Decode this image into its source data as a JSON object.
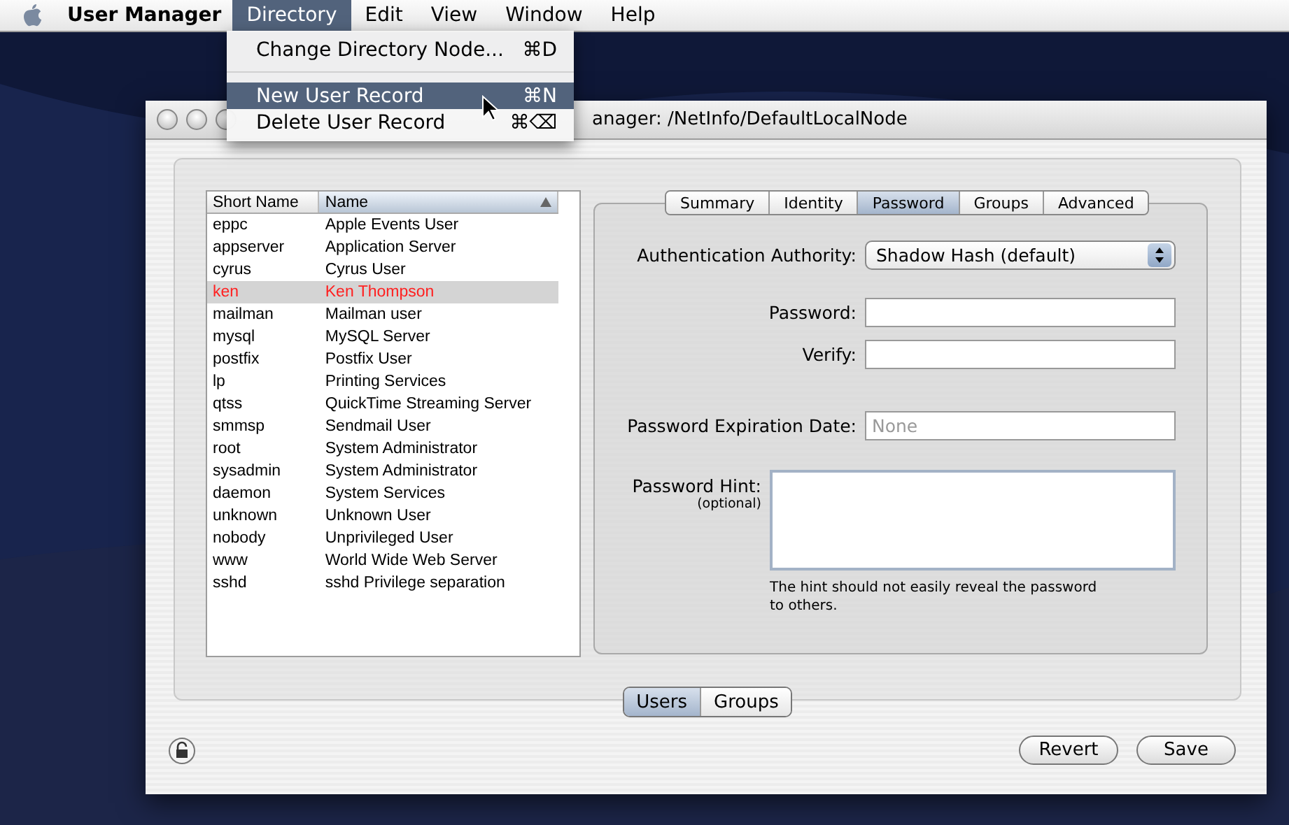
{
  "menubar": {
    "app": "User Manager",
    "items": [
      {
        "label": "Directory",
        "selected": true
      },
      {
        "label": "Edit",
        "selected": false
      },
      {
        "label": "View",
        "selected": false
      },
      {
        "label": "Window",
        "selected": false
      },
      {
        "label": "Help",
        "selected": false
      }
    ]
  },
  "menu": {
    "items": [
      {
        "kind": "item",
        "label": "Change Directory Node...",
        "shortcut": "⌘D",
        "selected": false
      },
      {
        "kind": "separator"
      },
      {
        "kind": "item",
        "label": "New User Record",
        "shortcut": "⌘N",
        "selected": true
      },
      {
        "kind": "item",
        "label": "Delete User Record",
        "shortcut": "⌘⌫",
        "selected": false
      }
    ]
  },
  "window": {
    "title": "anager: /NetInfo/DefaultLocalNode"
  },
  "table": {
    "columns": [
      {
        "label": "Short Name",
        "sorted": false
      },
      {
        "label": "Name",
        "sorted": true
      }
    ],
    "rows": [
      {
        "short_name": "eppc",
        "name": "Apple Events User",
        "selected": false
      },
      {
        "short_name": "appserver",
        "name": "Application Server",
        "selected": false
      },
      {
        "short_name": "cyrus",
        "name": "Cyrus User",
        "selected": false
      },
      {
        "short_name": "ken",
        "name": "Ken Thompson",
        "selected": true
      },
      {
        "short_name": "mailman",
        "name": "Mailman user",
        "selected": false
      },
      {
        "short_name": "mysql",
        "name": "MySQL Server",
        "selected": false
      },
      {
        "short_name": "postfix",
        "name": "Postfix User",
        "selected": false
      },
      {
        "short_name": "lp",
        "name": "Printing Services",
        "selected": false
      },
      {
        "short_name": "qtss",
        "name": "QuickTime Streaming Server",
        "selected": false
      },
      {
        "short_name": "smmsp",
        "name": "Sendmail User",
        "selected": false
      },
      {
        "short_name": "root",
        "name": "System Administrator",
        "selected": false
      },
      {
        "short_name": "sysadmin",
        "name": "System Administrator",
        "selected": false
      },
      {
        "short_name": "daemon",
        "name": "System Services",
        "selected": false
      },
      {
        "short_name": "unknown",
        "name": "Unknown User",
        "selected": false
      },
      {
        "short_name": "nobody",
        "name": "Unprivileged User",
        "selected": false
      },
      {
        "short_name": "www",
        "name": "World Wide Web Server",
        "selected": false
      },
      {
        "short_name": "sshd",
        "name": "sshd Privilege separation",
        "selected": false
      }
    ]
  },
  "tabs": [
    {
      "label": "Summary",
      "selected": false
    },
    {
      "label": "Identity",
      "selected": false
    },
    {
      "label": "Password",
      "selected": true
    },
    {
      "label": "Groups",
      "selected": false
    },
    {
      "label": "Advanced",
      "selected": false
    }
  ],
  "form": {
    "authority": {
      "label": "Authentication Authority:",
      "value": "Shadow Hash (default)"
    },
    "password": {
      "label": "Password:"
    },
    "verify": {
      "label": "Verify:"
    },
    "expiration": {
      "label": "Password Expiration Date:",
      "placeholder": "None"
    },
    "hint": {
      "label": "Password Hint:",
      "sublabel": "(optional)",
      "note": "The hint should not easily reveal the password to others."
    }
  },
  "segments": [
    {
      "label": "Users",
      "selected": true
    },
    {
      "label": "Groups",
      "selected": false
    }
  ],
  "buttons": [
    "Revert",
    "Save"
  ]
}
